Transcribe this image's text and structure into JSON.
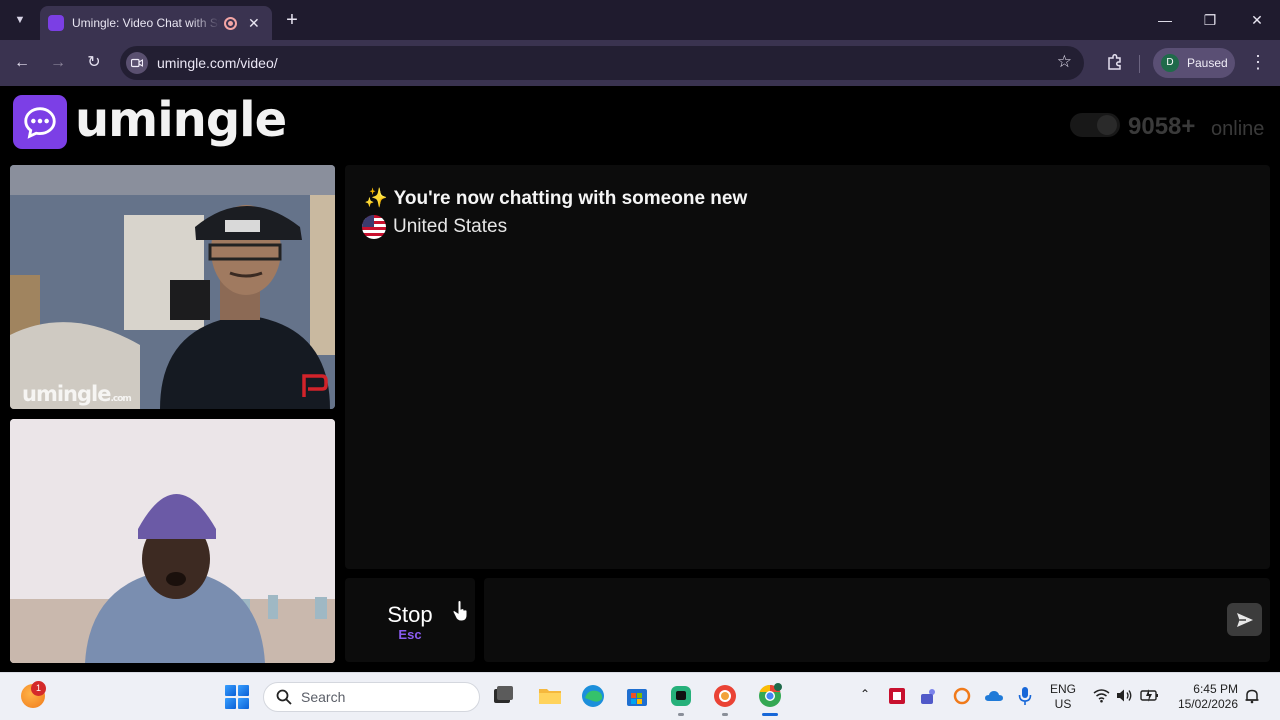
{
  "browser": {
    "tab_title": "Umingle: Video Chat with Strangers",
    "new_tab": "+",
    "url": "umingle.com/video/",
    "profile_initial": "D",
    "profile_status": "Paused",
    "window_minimize": "—",
    "window_restore": "❐",
    "window_close": "✕"
  },
  "site": {
    "logo_text": "umingle",
    "online_count": "9058+",
    "online_label": "online"
  },
  "videos": {
    "stranger_watermark": "umingle",
    "stranger_watermark_suffix": ".com"
  },
  "chat": {
    "sparkle": "✨",
    "status_message": "You're now chatting with someone new",
    "country": "United States"
  },
  "controls": {
    "stop_label": "Stop",
    "stop_hint": "Esc",
    "message_placeholder": ""
  },
  "taskbar": {
    "weather_badge": "1",
    "search_label": "Search",
    "lang_line1": "ENG",
    "lang_line2": "US",
    "time": "6:45 PM",
    "date": "15/02/2026"
  },
  "colors": {
    "brand_purple": "#7c3fe6",
    "chrome_dark": "#1f1b2e",
    "chrome_toolbar": "#3a3350"
  }
}
